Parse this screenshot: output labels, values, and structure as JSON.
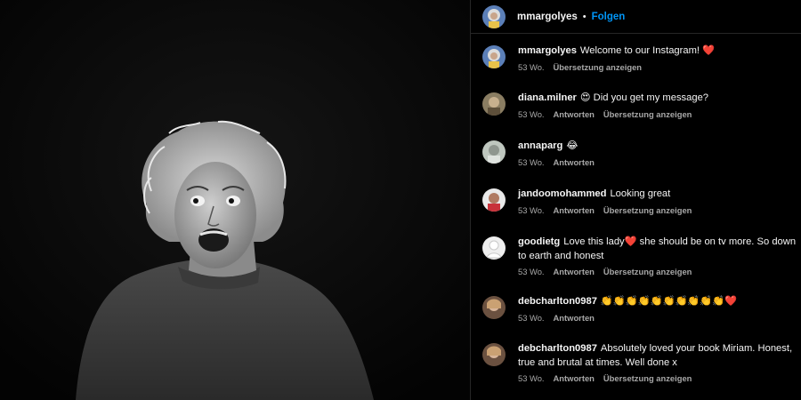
{
  "header": {
    "username": "mmargolyes",
    "separator": "•",
    "follow_label": "Folgen"
  },
  "comments": [
    {
      "username": "mmargolyes",
      "text": "Welcome to our Instagram! ❤️",
      "time": "53 Wo.",
      "actions": [
        "Übersetzung anzeigen"
      ]
    },
    {
      "username": "diana.milner",
      "text": "😍 Did you get my message?",
      "time": "53 Wo.",
      "actions": [
        "Antworten",
        "Übersetzung anzeigen"
      ]
    },
    {
      "username": "annaparg",
      "text": "😂",
      "time": "53 Wo.",
      "actions": [
        "Antworten"
      ]
    },
    {
      "username": "jandoomohammed",
      "text": "Looking great",
      "time": "53 Wo.",
      "actions": [
        "Antworten",
        "Übersetzung anzeigen"
      ]
    },
    {
      "username": "goodietg",
      "text": "Love this lady❤️  she should be on tv more. So down to earth and honest",
      "time": "53 Wo.",
      "actions": [
        "Antworten",
        "Übersetzung anzeigen"
      ]
    },
    {
      "username": "debcharlton0987",
      "text": "👏👏👏👏👏👏👏👏👏👏❤️",
      "time": "53 Wo.",
      "actions": [
        "Antworten"
      ]
    },
    {
      "username": "debcharlton0987",
      "text": "Absolutely loved your book Miriam. Honest, true and brutal at times. Well done x",
      "time": "53 Wo.",
      "actions": [
        "Antworten",
        "Übersetzung anzeigen"
      ]
    }
  ],
  "colors": {
    "background": "#000000",
    "text": "#f5f5f5",
    "secondary_text": "#a8a8a8",
    "follow_blue": "#0095f6",
    "divider": "#262626"
  }
}
